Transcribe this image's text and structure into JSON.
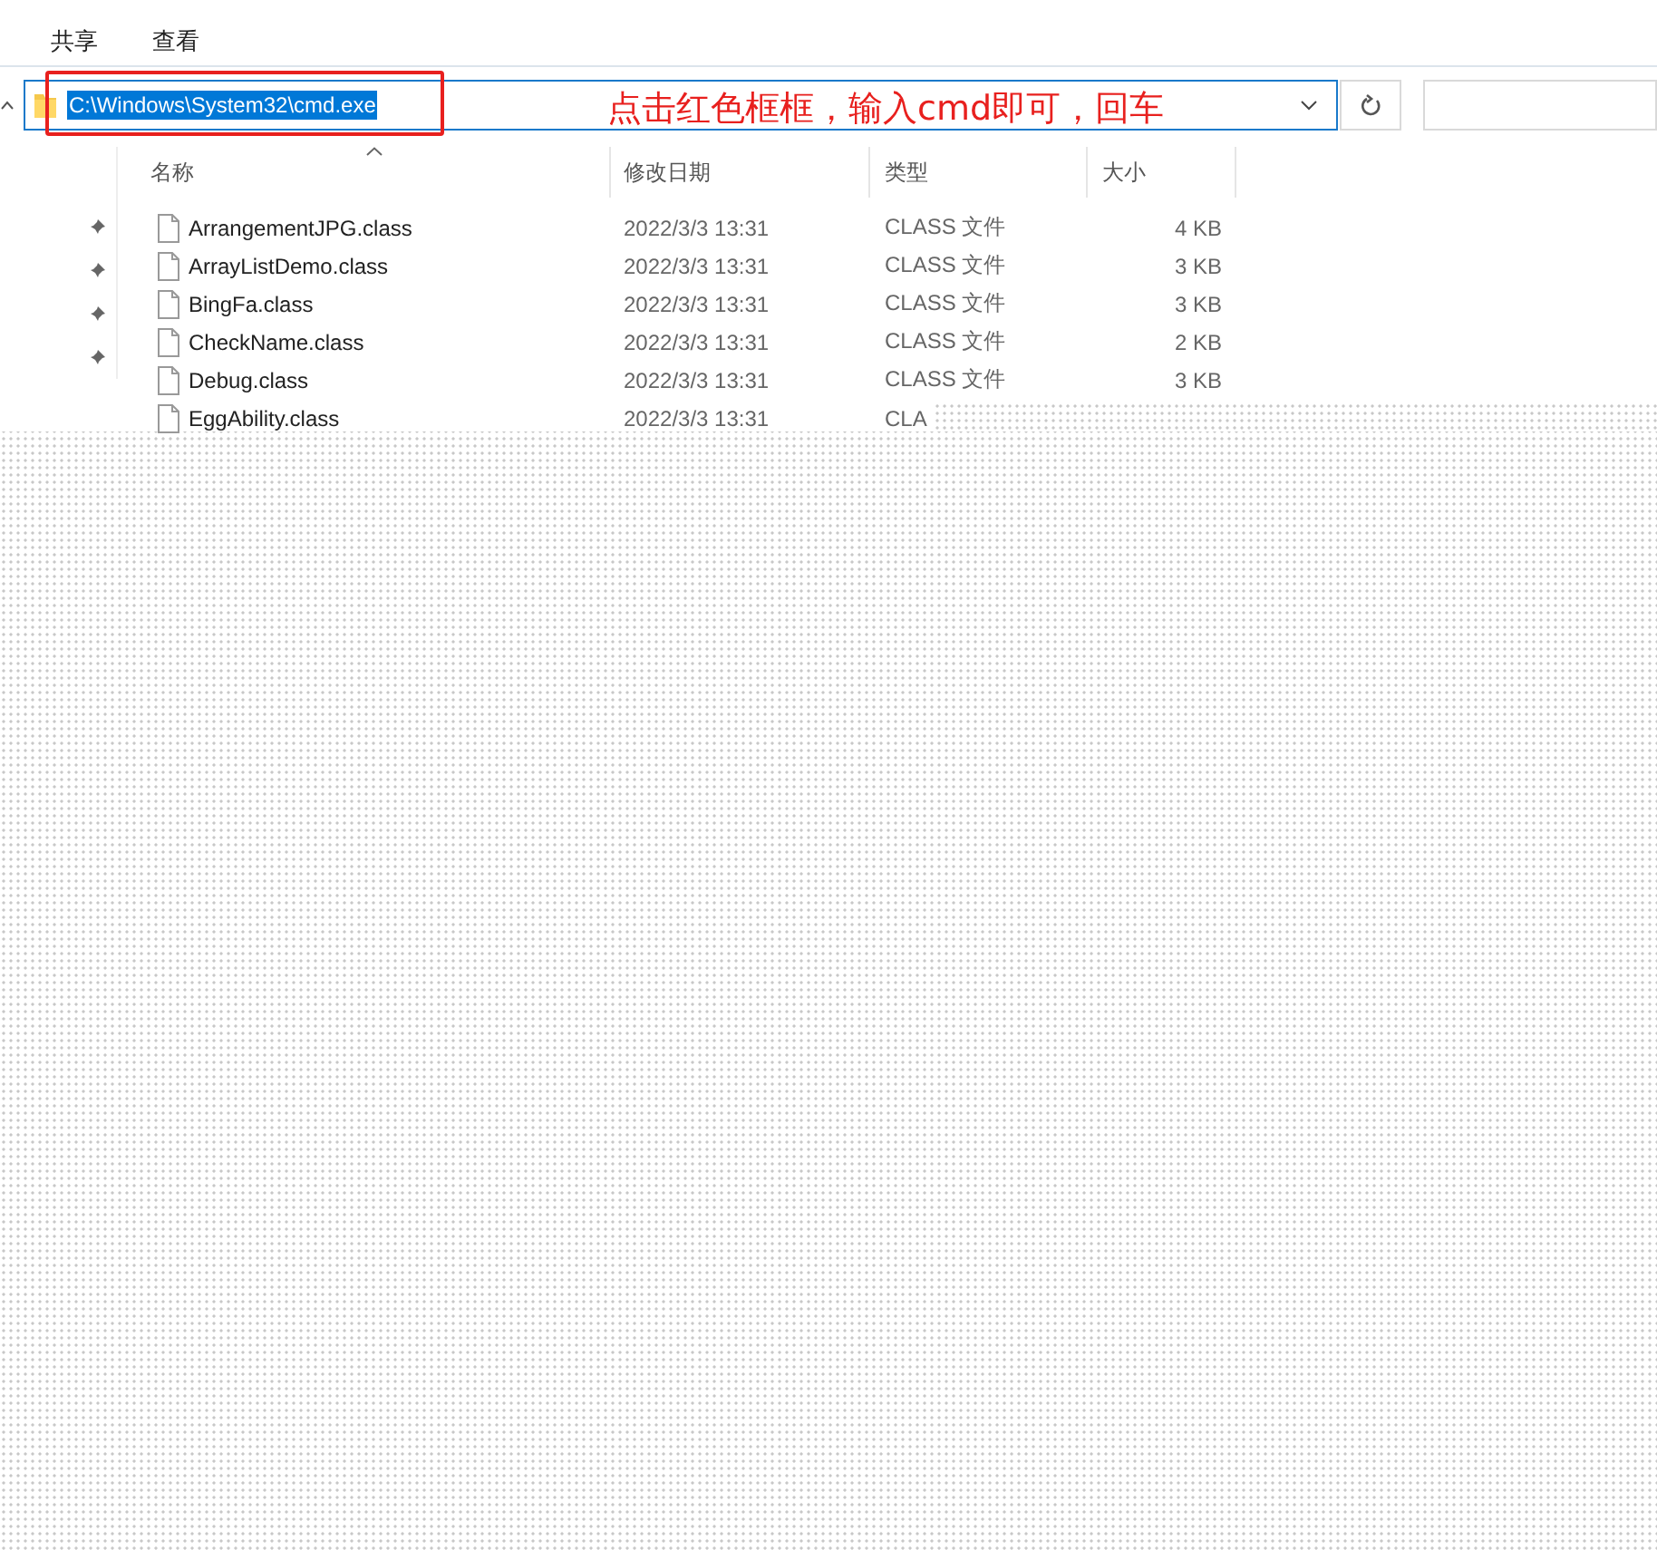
{
  "ribbon_tabs": [
    {
      "label": "共享"
    },
    {
      "label": "查看"
    }
  ],
  "address_bar": {
    "value": "C:\\Windows\\System32\\cmd.exe",
    "selected": true
  },
  "annotation": {
    "text": "点击红色框框，输入cmd即可，回车"
  },
  "nav_pane": [
    {
      "pinned": true
    },
    {
      "pinned": true
    },
    {
      "pinned": true
    },
    {
      "pinned": true
    }
  ],
  "columns": [
    {
      "label": "名称",
      "sorted": true
    },
    {
      "label": "修改日期",
      "sorted": false
    },
    {
      "label": "类型",
      "sorted": false
    },
    {
      "label": "大小",
      "sorted": false
    }
  ],
  "rows": [
    {
      "name": "ArrangementJPG.class",
      "modified": "2022/3/3 13:31",
      "type": "CLASS 文件",
      "size": "4 KB"
    },
    {
      "name": "ArrayListDemo.class",
      "modified": "2022/3/3 13:31",
      "type": "CLASS 文件",
      "size": "3 KB"
    },
    {
      "name": "BingFa.class",
      "modified": "2022/3/3 13:31",
      "type": "CLASS 文件",
      "size": "3 KB"
    },
    {
      "name": "CheckName.class",
      "modified": "2022/3/3 13:31",
      "type": "CLASS 文件",
      "size": "2 KB"
    },
    {
      "name": "Debug.class",
      "modified": "2022/3/3 13:31",
      "type": "CLASS 文件",
      "size": "3 KB"
    },
    {
      "name": "EggAbility.class",
      "modified": "2022/3/3 13:31",
      "type": "CLA"
    }
  ]
}
